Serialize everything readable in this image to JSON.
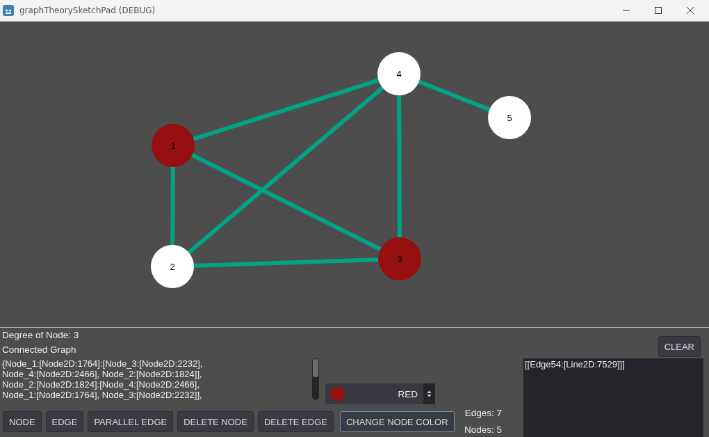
{
  "window": {
    "title": "graphTheorySketchPad (DEBUG)"
  },
  "graph": {
    "nodes": [
      {
        "label": "1",
        "color": "#961010"
      },
      {
        "label": "2",
        "color": "#ffffff"
      },
      {
        "label": "3",
        "color": "#961010"
      },
      {
        "label": "4",
        "color": "#ffffff"
      },
      {
        "label": "5",
        "color": "#ffffff"
      }
    ]
  },
  "info": {
    "degree": "Degree of Node: 3",
    "connectivity": "Connected Graph",
    "adjacency": [
      "{Node_1:[Node2D:1764]:[Node_3:[Node2D:2232],",
      "Node_4:[Node2D:2466], Node_2:[Node2D:1824]],",
      "Node_2:[Node2D:1824]:[Node_4:[Node2D:2466],",
      "Node_1:[Node2D:1764], Node_3:[Node2D:2232]],"
    ]
  },
  "color_picker": {
    "value": "RED",
    "color": "#961010"
  },
  "buttons": [
    {
      "label": "NODE",
      "focused": false
    },
    {
      "label": "EDGE",
      "focused": false
    },
    {
      "label": "PARALLEL EDGE",
      "focused": false
    },
    {
      "label": "DELETE NODE",
      "focused": false
    },
    {
      "label": "DELETE EDGE",
      "focused": false
    },
    {
      "label": "CHANGE NODE COLOR",
      "focused": true
    }
  ],
  "counts": {
    "edges": "Edges: 7",
    "nodes": "Nodes: 5"
  },
  "clear_button": "CLEAR",
  "log": [
    "[[Edge54:[Line2D:7529]]]"
  ]
}
